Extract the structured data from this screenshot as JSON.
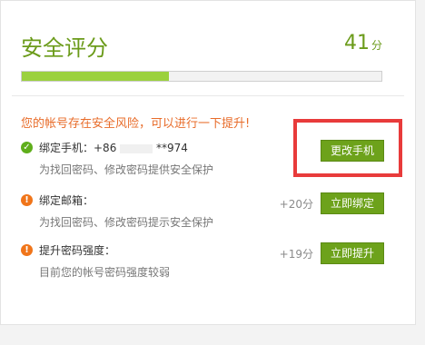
{
  "header": {
    "title": "安全评分",
    "score": "41",
    "score_unit": "分",
    "progress_fraction": 0.41
  },
  "warning": "您的帐号存在安全风险，可以进行一下提升!",
  "items": [
    {
      "label": "绑定手机：+86",
      "masked_suffix": "**974",
      "desc": "为找回密码、修改密码提供安全保护",
      "button": "更改手机"
    },
    {
      "label": "绑定邮箱：",
      "desc": "为找回密码、修改密码提示安全保护",
      "points": "+20分",
      "button": "立即绑定"
    },
    {
      "label": "提升密码强度：",
      "desc": "目前您的帐号密码强度较弱",
      "points": "+19分",
      "button": "立即提升"
    }
  ],
  "icons": {
    "ok": "check-circle-icon",
    "alert": "exclamation-circle-icon"
  },
  "colors": {
    "accent": "#6da21b",
    "warning": "#e86c2a",
    "highlight": "#e83b3b"
  }
}
